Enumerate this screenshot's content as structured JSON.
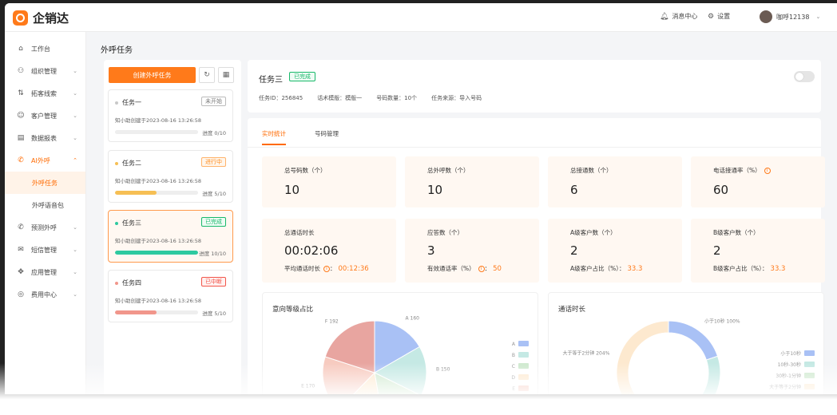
{
  "header": {
    "logo_text": "企销达",
    "notice_label": "消息中心",
    "settings_label": "设置",
    "user_name": "咖呼12138"
  },
  "sidebar": {
    "items": [
      {
        "label": "工作台",
        "icon": "home-icon"
      },
      {
        "label": "组织管理",
        "icon": "org-icon"
      },
      {
        "label": "拓客线索",
        "icon": "leads-icon"
      },
      {
        "label": "客户管理",
        "icon": "customer-icon"
      },
      {
        "label": "数据报表",
        "icon": "report-icon"
      },
      {
        "label": "AI外呼",
        "icon": "phone-icon"
      },
      {
        "label": "预测外呼",
        "icon": "predict-call-icon"
      },
      {
        "label": "短信管理",
        "icon": "sms-icon"
      },
      {
        "label": "应用管理",
        "icon": "apps-icon"
      },
      {
        "label": "费用中心",
        "icon": "fee-icon"
      }
    ],
    "sub_items": [
      {
        "label": "外呼任务"
      },
      {
        "label": "外呼语音包"
      }
    ]
  },
  "page_title": "外呼任务",
  "task_panel": {
    "create_label": "创建外呼任务",
    "tasks": [
      {
        "name": "任务一",
        "status": "未开始",
        "creator": "知小助创建于2023-08-16 13:26:58",
        "progress_text": "进度 0/10",
        "progress": 0.0,
        "color": "#c8c8c8",
        "status_color": "#777777"
      },
      {
        "name": "任务二",
        "status": "进行中",
        "creator": "知小助创建于2023-08-16 13:26:58",
        "progress_text": "进度 5/10",
        "progress": 0.5,
        "color": "#f6bf54",
        "status_color": "#ff8a1a"
      },
      {
        "name": "任务三",
        "status": "已完成",
        "creator": "知小助创建于2023-08-16 13:26:58",
        "progress_text": "进度 10/10",
        "progress": 1.0,
        "color": "#2ec9a0",
        "status_color": "#18b96a"
      },
      {
        "name": "任务四",
        "status": "已中断",
        "creator": "知小助创建于2023-08-16 13:26:58",
        "progress_text": "进度 5/10",
        "progress": 0.5,
        "color": "#f1968b",
        "status_color": "#f2554a"
      }
    ]
  },
  "detail": {
    "title": "任务三",
    "status": "已完成",
    "meta": [
      "任务ID：256845",
      "话术模版：模版一",
      "号码数量：10个",
      "任务来源：导入号码"
    ],
    "tabs": [
      "实时统计",
      "号码管理"
    ],
    "stats": [
      {
        "label": "总号码数（个）",
        "value": "10"
      },
      {
        "label": "总外呼数（个）",
        "value": "10"
      },
      {
        "label": "总接通数（个）",
        "value": "6"
      },
      {
        "label": "电话接通率（%）",
        "value": "60"
      },
      {
        "label": "总通话时长",
        "value": "00:02:06",
        "sub_label": "平均通话时长",
        "sub_value": "00:12:36"
      },
      {
        "label": "应答数（个）",
        "value": "3",
        "sub_label": "有效通话率（%）",
        "sub_value": "50"
      },
      {
        "label": "A级客户数（个）",
        "value": "2",
        "sub_label": "A级客户占比（%）：",
        "sub_value": "33.3"
      },
      {
        "label": "B级客户数（个）",
        "value": "2",
        "sub_label": "B级客户占比（%）：",
        "sub_value": "33.3"
      }
    ],
    "charts": [
      {
        "title": "意向等级占比"
      },
      {
        "title": "通话时长"
      }
    ]
  },
  "chart_data": [
    {
      "type": "pie",
      "title": "意向等级占比",
      "categories": [
        "A",
        "B",
        "C",
        "D",
        "E",
        "F"
      ],
      "values": [
        160,
        150,
        144,
        144,
        170,
        192
      ],
      "colors": [
        "#a9c1f5",
        "#c5e9e4",
        "#cfe9cf",
        "#fde9cf",
        "#f7cbc0",
        "#e8a5a0"
      ]
    },
    {
      "type": "pie",
      "title": "通话时长",
      "categories": [
        "小于10秒",
        "10秒-30秒",
        "30秒-1分钟",
        "大于等于2分钟"
      ],
      "values": [
        100,
        120,
        80,
        204
      ],
      "labels": [
        "小于10秒 100%",
        "",
        "",
        "大于等于2分钟 204%"
      ],
      "colors": [
        "#a9c1f5",
        "#c5e9e4",
        "#cfe9cf",
        "#fde9cf"
      ]
    }
  ]
}
